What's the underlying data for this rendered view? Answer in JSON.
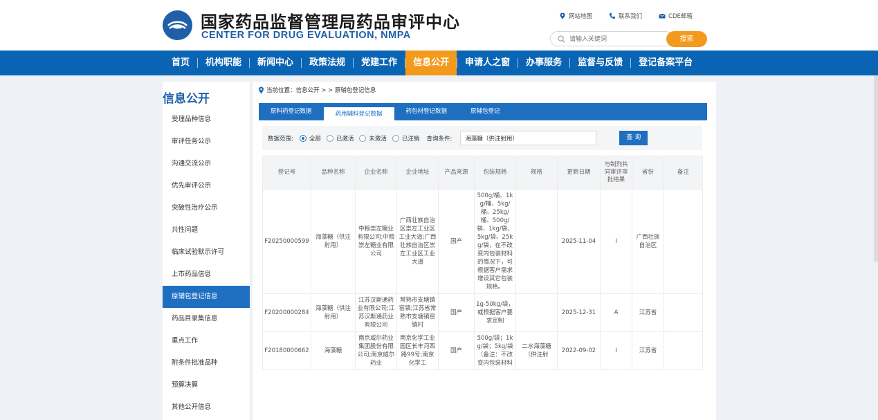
{
  "header": {
    "title": "国家药品监督管理局药品审评中心",
    "subtitle": "CENTER FOR DRUG EVALUATION, NMPA",
    "links": [
      {
        "label": "网站地图",
        "icon": "location-pin-icon"
      },
      {
        "label": "联系我们",
        "icon": "phone-icon"
      },
      {
        "label": "CDE邮箱",
        "icon": "mail-icon"
      }
    ],
    "search_placeholder": "请输入关键词",
    "search_button": "搜索"
  },
  "nav": {
    "items": [
      "首页",
      "机构职能",
      "新闻中心",
      "政策法规",
      "党建工作",
      "信息公开",
      "申请人之窗",
      "办事服务",
      "监督与反馈",
      "登记备案平台"
    ],
    "active": "信息公开"
  },
  "sidebar": {
    "title": "信息公开",
    "items": [
      "受理品种信息",
      "审评任务公示",
      "沟通交流公示",
      "优先审评公示",
      "突破性治疗公示",
      "共性问题",
      "临床试验默示许可",
      "上市药品信息",
      "原辅包登记信息",
      "药品目录集信息",
      "重点工作",
      "附条件批准品种",
      "预算决算",
      "其他公开信息"
    ],
    "active": "原辅包登记信息"
  },
  "breadcrumb": {
    "prefix": "当前位置：",
    "path": "信息公开 > > 原辅包登记信息"
  },
  "tabs": {
    "items": [
      "原料药登记数据",
      "药用辅料登记数据",
      "药包材登记数据",
      "原辅包登记"
    ],
    "active": "药用辅料登记数据"
  },
  "filter": {
    "range_label": "数据范围:",
    "options": [
      "全部",
      "已激活",
      "未激活",
      "已注销"
    ],
    "selected": "全部",
    "condition_label": "查询条件:",
    "condition_value": "海藻糖（供注射用）",
    "query_button": "查 询"
  },
  "table": {
    "headers": [
      "登记号",
      "品种名称",
      "企业名称",
      "企业地址",
      "产品来源",
      "包装规格",
      "规格",
      "更新日期",
      "与制剂共同审评审批结果",
      "省份",
      "备注"
    ],
    "rows": [
      [
        "F20250000599",
        "海藻糖（供注射用）",
        "中粮崇左糖业有限公司;中粮崇左糖业有限公司",
        "广西壮族自治区崇左工业区工业大道;广西壮族自治区崇左工业区工业大道",
        "国产",
        "500g/桶、1kg/桶、5kg/桶、25kg/桶、500g/袋、1kg/袋、5kg/袋、25kg/袋，在不改变内包装材料的情况下，可根据客户需求增设其它包装规格。",
        "",
        "2025-11-04",
        "I",
        "广西壮族自治区",
        ""
      ],
      [
        "F20200000284",
        "海藻糖（供注射用）",
        "江苏汉斯通药业有限公司;江苏汉斯通药业有限公司",
        "常熟市支塘镇窑镇;江苏省常熟市支塘镇窑镇村",
        "国产",
        "1g-50kg/袋，或根据客户要求定制",
        "",
        "2025-12-31",
        "A",
        "江苏省",
        ""
      ],
      [
        "F20180000662",
        "海藻糖",
        "南京威尔药业集团股份有限公司;南京威尔药业",
        "南京化学工业园区长丰河西路99号;南京化学工",
        "国产",
        "500g/袋；1kg/袋；5kg/袋（备注：不改变内包装材料",
        "二水海藻糖（供注射",
        "2022-09-02",
        "I",
        "江苏省",
        ""
      ]
    ]
  },
  "colors": {
    "brand_blue": "#0a64b4",
    "accent_orange": "#f39a1d",
    "tab_blue": "#1f6fc1"
  }
}
